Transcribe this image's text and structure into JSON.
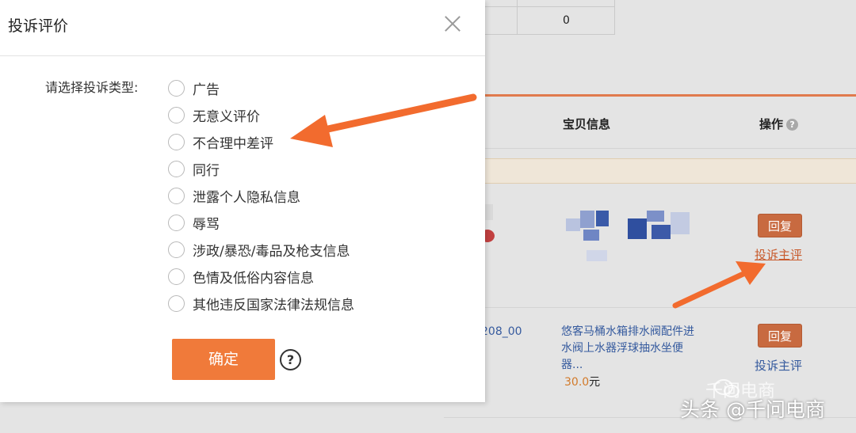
{
  "modal": {
    "title": "投诉评价",
    "type_label": "请选择投诉类型:",
    "options": [
      "广告",
      "无意义评价",
      "不合理中差评",
      "同行",
      "泄露个人隐私信息",
      "辱骂",
      "涉政/暴恐/毒品及枪支信息",
      "色情及低俗内容信息",
      "其他违反国家法律法规信息"
    ],
    "confirm_label": "确定",
    "help_symbol": "?"
  },
  "background": {
    "top_cell_value": "0",
    "columns": {
      "info": "宝贝信息",
      "operation": "操作"
    },
    "rows": [
      {
        "reply_label": "回复",
        "complain_label": "投诉主评"
      },
      {
        "order_fragment": "208_00",
        "product_title": "悠客马桶水箱排水阀配件进水阀上水器浮球抽水坐便器...",
        "price_value": "30.0",
        "price_unit": "元",
        "reply_label": "回复",
        "complain_label": "投诉主评"
      }
    ]
  },
  "watermark": {
    "main": "头条 @千问电商",
    "faint": "千问电商"
  },
  "colors": {
    "accent_orange": "#f07a3a",
    "link_blue": "#355a9e",
    "arrow_orange": "#f26b2e"
  }
}
